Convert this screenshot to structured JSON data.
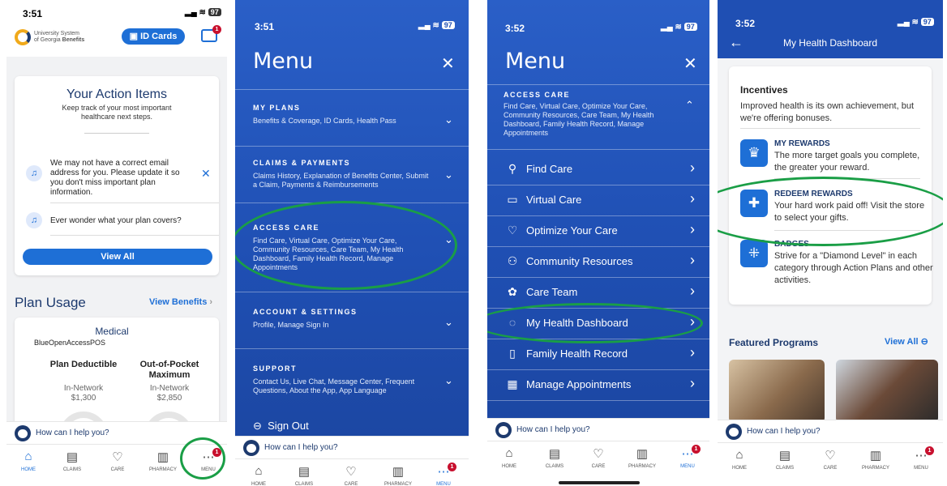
{
  "colors": {
    "brand_blue": "#1e6fd6",
    "navy": "#1d3a6e",
    "menu_blue": "#2459c2",
    "highlight_green": "#1a9e46",
    "badge_red": "#c8102e"
  },
  "tabbar": {
    "home": "HOME",
    "claims": "CLAIMS",
    "care": "CARE",
    "pharmacy": "PHARMACY",
    "menu": "MENU"
  },
  "help": {
    "text": "How can I help you?"
  },
  "screen1": {
    "time": "3:51",
    "battery": "97",
    "logo_line1": "University System",
    "logo_line2": "of Georgia",
    "logo_line2b": "Benefits",
    "id_cards_label": "ID Cards",
    "mail_badge": "1",
    "action_title": "Your Action Items",
    "action_subtitle": "Keep track of your most important healthcare next steps.",
    "notice_email": "We may not have a correct email address for you. Please update it so you don't miss important plan information.",
    "notice_plan": "Ever wonder what your plan covers?",
    "view_all": "View All",
    "plan_usage_title": "Plan Usage",
    "view_benefits": "View Benefits",
    "medical_label": "Medical",
    "plan_name": "BlueOpenAccessPOS",
    "deductible_label": "Plan Deductible",
    "deductible_network": "In-Network",
    "deductible_value": "$1,300",
    "oop_label": "Out-of-Pocket Maximum",
    "oop_network": "In-Network",
    "oop_value": "$2,850",
    "menu_badge": "1"
  },
  "screen2": {
    "time": "3:51",
    "battery": "97",
    "menu_title": "Menu",
    "sections": [
      {
        "title": "MY PLANS",
        "subtitle": "Benefits & Coverage, ID Cards, Health Pass"
      },
      {
        "title": "CLAIMS & PAYMENTS",
        "subtitle": "Claims History, Explanation of Benefits Center, Submit a Claim, Payments & Reimbursements"
      },
      {
        "title": "ACCESS CARE",
        "subtitle": "Find Care, Virtual Care, Optimize Your Care, Community Resources, Care Team, My Health Dashboard, Family Health Record, Manage Appointments"
      },
      {
        "title": "ACCOUNT & SETTINGS",
        "subtitle": "Profile, Manage Sign In"
      },
      {
        "title": "SUPPORT",
        "subtitle": "Contact Us, Live Chat, Message Center, Frequent Questions, About the App, App Language"
      }
    ],
    "sign_out": "Sign Out",
    "menu_badge": "1"
  },
  "screen3": {
    "time": "3:52",
    "battery": "97",
    "menu_title": "Menu",
    "section_title": "ACCESS CARE",
    "section_subtitle": "Find Care, Virtual Care, Optimize Your Care, Community Resources, Care Team, My Health Dashboard, Family Health Record, Manage Appointments",
    "items": [
      {
        "label": "Find Care",
        "icon": "search-icon"
      },
      {
        "label": "Virtual Care",
        "icon": "video-icon"
      },
      {
        "label": "Optimize Your Care",
        "icon": "heart-icon"
      },
      {
        "label": "Community Resources",
        "icon": "people-icon"
      },
      {
        "label": "Care Team",
        "icon": "care-team-icon"
      },
      {
        "label": "My Health Dashboard",
        "icon": "apple-icon"
      },
      {
        "label": "Family Health Record",
        "icon": "record-icon"
      },
      {
        "label": "Manage Appointments",
        "icon": "calendar-icon"
      }
    ],
    "menu_badge": "1"
  },
  "screen4": {
    "time": "3:52",
    "battery": "97",
    "header_title": "My Health Dashboard",
    "incentives_title": "Incentives",
    "incentives_desc": "Improved health is its own achievement, but we're offering bonuses.",
    "my_rewards_title": "MY REWARDS",
    "my_rewards_desc": "The more target goals you complete, the greater your reward.",
    "redeem_title": "REDEEM REWARDS",
    "redeem_desc": "Your hard work paid off! Visit the store to select your gifts.",
    "badges_title": "BADGES",
    "badges_desc": "Strive for a \"Diamond Level\" in each category through Action Plans and other activities.",
    "featured_title": "Featured Programs",
    "view_all": "View All",
    "menu_badge": "1"
  }
}
